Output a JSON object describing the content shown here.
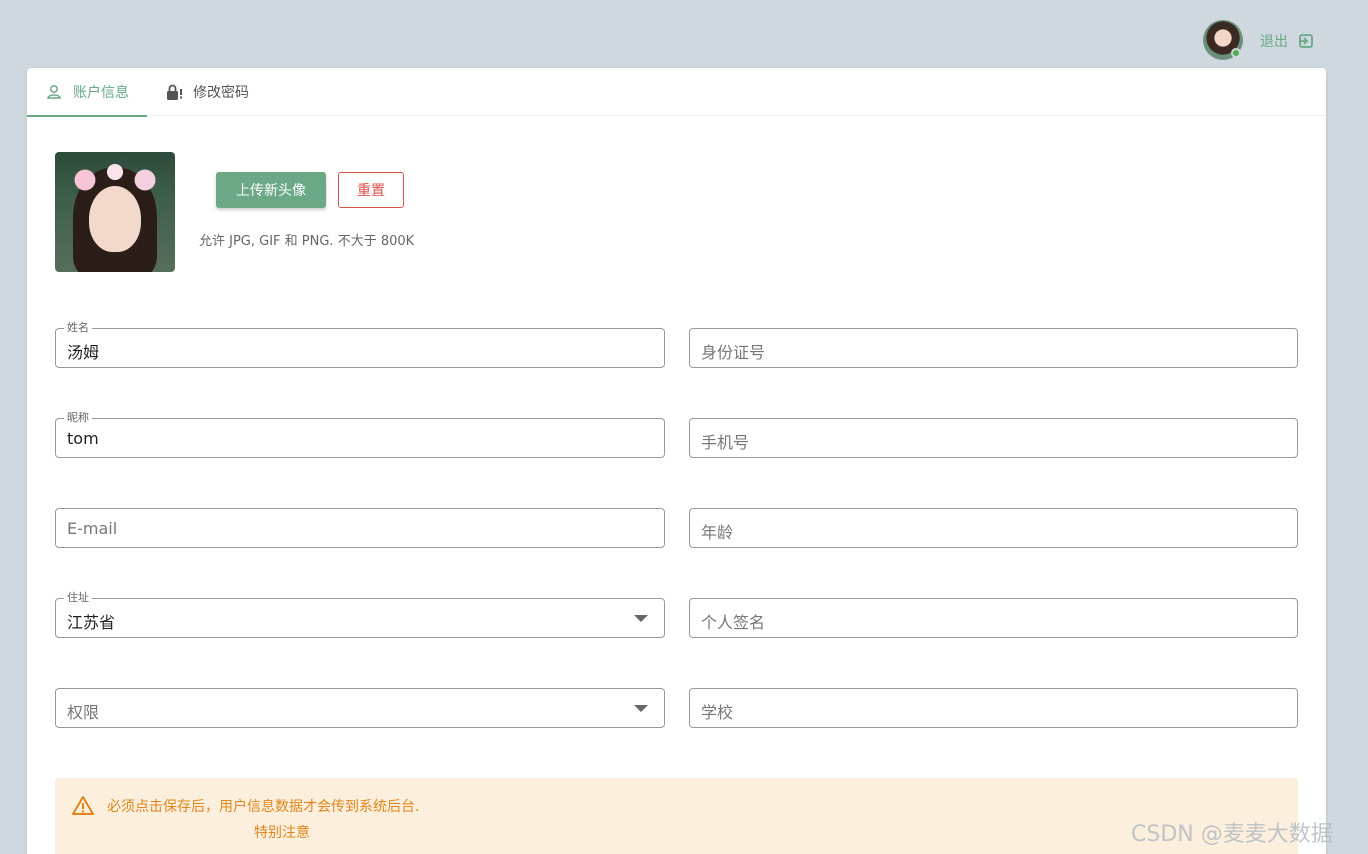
{
  "header": {
    "logout_label": "退出"
  },
  "tabs": [
    {
      "label": "账户信息",
      "icon": "person-outline-icon",
      "active": true
    },
    {
      "label": "修改密码",
      "icon": "lock-alert-icon",
      "active": false
    }
  ],
  "avatar": {
    "upload_label": "上传新头像",
    "reset_label": "重置",
    "hint": "允许 JPG, GIF 和 PNG. 不大于 800K"
  },
  "form": {
    "name": {
      "label": "姓名",
      "value": "汤姆"
    },
    "id_card": {
      "placeholder": "身份证号"
    },
    "nickname": {
      "label": "昵称",
      "value": "tom"
    },
    "phone": {
      "placeholder": "手机号"
    },
    "email": {
      "placeholder": "E-mail"
    },
    "age": {
      "placeholder": "年龄"
    },
    "address": {
      "label": "住址",
      "value": "江苏省"
    },
    "signature": {
      "placeholder": "个人签名"
    },
    "permission": {
      "placeholder": "权限"
    },
    "school": {
      "placeholder": "学校"
    }
  },
  "alert": {
    "text": "必须点击保存后，用户信息数据才会传到系统后台.",
    "subtext": "特别注意"
  },
  "watermark": "CSDN @麦麦大数据",
  "colors": {
    "accent": "#6aa886",
    "danger": "#e0504a",
    "warning": "#e0861b",
    "warning_bg": "#fdefdd",
    "page_bg": "#cfd8df"
  }
}
